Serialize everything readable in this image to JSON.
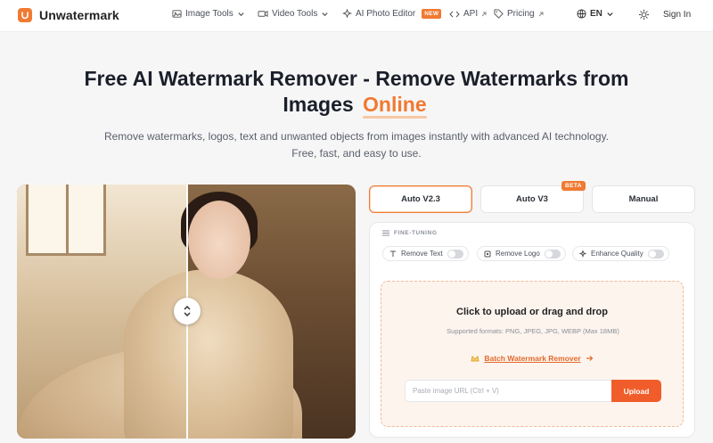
{
  "brand": {
    "name": "Unwatermark",
    "accent": "#f07a32"
  },
  "nav": {
    "items": [
      {
        "label": "Image Tools",
        "icon": "image-icon",
        "dropdown": true
      },
      {
        "label": "Video Tools",
        "icon": "video-icon",
        "dropdown": true
      },
      {
        "label": "AI Photo Editor",
        "icon": "sparkle-icon",
        "badge": "NEW"
      },
      {
        "label": "API",
        "icon": "code-icon"
      },
      {
        "label": "Pricing",
        "icon": "tag-icon"
      }
    ],
    "language": "EN",
    "signin": "Sign In"
  },
  "hero": {
    "title_line1": "Free AI Watermark Remover - Remove Watermarks from",
    "title_line2": "Images",
    "title_accent": "Online",
    "subtitle": "Remove watermarks, logos, text and unwanted objects from images instantly with advanced AI technology. Free, fast, and easy to use."
  },
  "modes": [
    {
      "label": "Auto V2.3",
      "active": true
    },
    {
      "label": "Auto V3",
      "badge": "BETA"
    },
    {
      "label": "Manual"
    }
  ],
  "fine_tuning": {
    "label": "FINE-TUNING",
    "options": [
      {
        "label": "Remove Text",
        "icon": "text-icon",
        "enabled": false
      },
      {
        "label": "Remove Logo",
        "icon": "logo-icon",
        "enabled": false
      },
      {
        "label": "Enhance Quality",
        "icon": "sparkle-icon",
        "enabled": false
      }
    ]
  },
  "upload": {
    "title": "Click to upload or drag and drop",
    "formats": "Supported formats: PNG, JPEG, JPG, WEBP (Max 18MB)",
    "batch_label": "Batch Watermark Remover",
    "url_placeholder": "Paste image URL (Ctrl + V)",
    "upload_button": "Upload"
  }
}
